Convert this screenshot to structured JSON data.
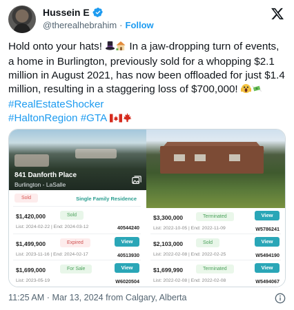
{
  "tweet": {
    "author": {
      "display_name": "Hussein E",
      "handle": "@therealhebrahim",
      "follow_label": "Follow",
      "verified_icon": "verified-badge-icon"
    },
    "text_parts": {
      "p1": "Hold onto your hats! ",
      "p2": " In a jaw-dropping turn of events, a home in Burlington, previously sold for a whopping $2.1 million in August 2021, has now been offloaded for just $1.4 million, resulting in a staggering loss of $700,000! ",
      "hashtag1": "#RealEstateShocker",
      "hashtag2": "#HaltonRegion",
      "hashtag3": "#GTA"
    },
    "timestamp": "11:25 AM · Mar 13, 2024 from Calgary, Alberta"
  },
  "left_card": {
    "address": "841 Danforth Place",
    "area": "Burlington - LaSalle",
    "status": "Sold",
    "property_type": "Single Family Residence",
    "listings": [
      {
        "price": "$1,420,000",
        "badge": "Sold",
        "dates": "List: 2024-02-22 | End: 2024-03-12",
        "mls": "40544240"
      },
      {
        "price": "$1,499,900",
        "badge": "Expired",
        "dates": "List: 2023-11-16 | End: 2024-02-17",
        "mls": "40513930",
        "button": "View"
      },
      {
        "price": "$1,699,000",
        "badge": "For Sale",
        "dates": "List: 2023-05-19",
        "mls": "W6020504",
        "button": "View"
      }
    ]
  },
  "right_card": {
    "listings": [
      {
        "price": "$3,300,000",
        "badge": "Terminated",
        "dates": "List: 2022-10-05 | End: 2022-11-09",
        "mls": "W5786241",
        "button": "View"
      },
      {
        "price": "$2,103,000",
        "badge": "Sold",
        "dates": "List: 2022-02-08 | End: 2022-02-25",
        "mls": "W5494190",
        "button": "View"
      },
      {
        "price": "$1,699,990",
        "badge": "Terminated",
        "dates": "List: 2022-02-08 | End: 2022-02-08",
        "mls": "W5494067",
        "button": "View"
      }
    ]
  },
  "colors": {
    "link": "#1d9bf0",
    "teal_button": "#2aa6b7",
    "text_primary": "#0f1419",
    "text_secondary": "#536471"
  }
}
